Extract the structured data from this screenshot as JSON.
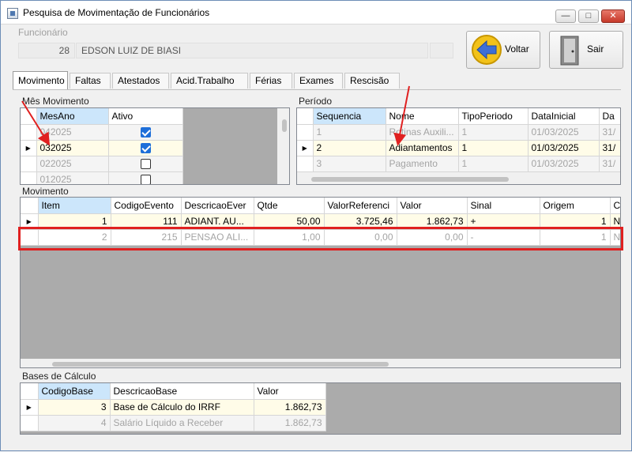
{
  "window": {
    "title": "Pesquisa de Movimentação de Funcionários",
    "controls": [
      "minimize-icon",
      "maximize-icon",
      "close-icon"
    ]
  },
  "funcionario": {
    "label": "Funcionário",
    "code": "28",
    "name": "EDSON LUIZ DE BIASI"
  },
  "buttons": {
    "voltar": "Voltar",
    "sair": "Sair",
    "voltar_icon": "back-arrow-icon",
    "sair_icon": "exit-door-icon"
  },
  "tabs": [
    "Movimento",
    "Faltas",
    "Atestados",
    "Acid.Trabalho",
    "Férias",
    "Exames",
    "Rescisão"
  ],
  "mes_movimento": {
    "label": "Mês Movimento",
    "columns": [
      "MesAno",
      "Ativo"
    ],
    "rows": [
      {
        "mesano": "042025",
        "ativo": true
      },
      {
        "mesano": "032025",
        "ativo": true
      },
      {
        "mesano": "022025",
        "ativo": false
      },
      {
        "mesano": "012025",
        "ativo": false
      }
    ]
  },
  "periodo": {
    "label": "Período",
    "columns": [
      "Sequencia",
      "Nome",
      "TipoPeriodo",
      "DataInicial",
      "Da"
    ],
    "rows": [
      {
        "sequencia": "1",
        "nome": "Rotinas Auxili...",
        "tipo": "1",
        "data_inicial": "01/03/2025",
        "da": "31/"
      },
      {
        "sequencia": "2",
        "nome": "Adiantamentos",
        "tipo": "1",
        "data_inicial": "01/03/2025",
        "da": "31/"
      },
      {
        "sequencia": "3",
        "nome": "Pagamento",
        "tipo": "1",
        "data_inicial": "01/03/2025",
        "da": "31/"
      }
    ]
  },
  "movimento": {
    "label": "Movimento",
    "columns": [
      "Item",
      "CodigoEvento",
      "DescricaoEver",
      "Qtde",
      "ValorReferenci",
      "Valor",
      "Sinal",
      "Origem",
      "C"
    ],
    "rows": [
      {
        "item": "1",
        "codigo": "111",
        "descricao": "ADIANT. AU...",
        "qtde": "50,00",
        "valor_ref": "3.725,46",
        "valor": "1.862,73",
        "sinal": "+",
        "origem": "1",
        "c": "N"
      },
      {
        "item": "2",
        "codigo": "215",
        "descricao": "PENSAO ALI...",
        "qtde": "1,00",
        "valor_ref": "0,00",
        "valor": "0,00",
        "sinal": "-",
        "origem": "1",
        "c": "N"
      }
    ]
  },
  "bases": {
    "label": "Bases de Cálculo",
    "columns": [
      "CodigoBase",
      "DescricaoBase",
      "Valor"
    ],
    "rows": [
      {
        "codigo": "3",
        "descricao": "Base de Cálculo do IRRF",
        "valor": "1.862,73"
      },
      {
        "codigo": "4",
        "descricao": "Salário Líquido a Receber",
        "valor": "1.862,73"
      }
    ]
  },
  "annotations": {
    "arrow_color": "#e02020",
    "highlight_color": "#e02020"
  }
}
